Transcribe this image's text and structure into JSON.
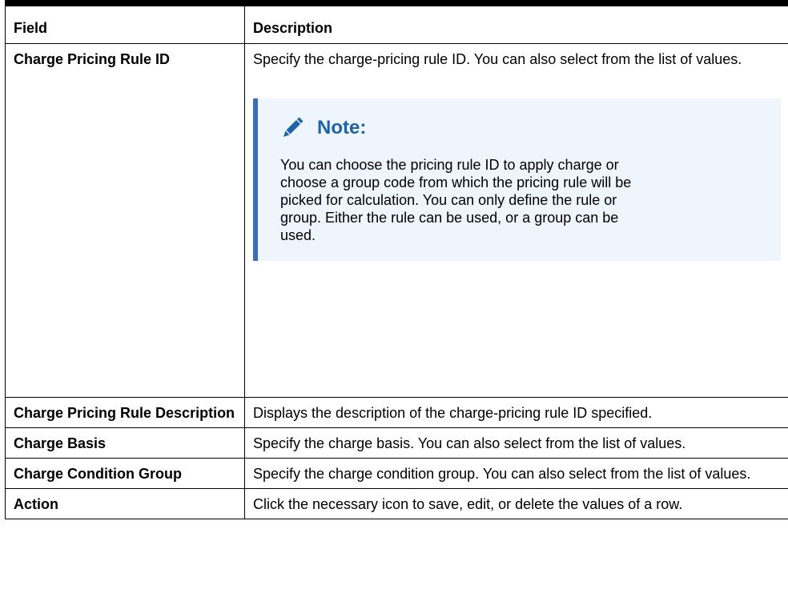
{
  "table": {
    "header": {
      "field": "Field",
      "description": "Description"
    },
    "rows": [
      {
        "field": "Charge Pricing Rule ID",
        "description": "Specify the charge-pricing rule ID. You can also select from the list of values.",
        "note": {
          "icon": "pencil-icon",
          "title": "Note:",
          "text": "You can choose the pricing rule ID to apply charge or choose a group code from which the pricing rule will be picked for calculation. You can only define the rule or group. Either the rule can be used, or a group can be used."
        }
      },
      {
        "field": "Charge Pricing Rule Description",
        "description": "Displays the description of the charge-pricing rule ID specified."
      },
      {
        "field": "Charge Basis",
        "description": "Specify the charge basis. You can also select from the list of values."
      },
      {
        "field": "Charge Condition Group",
        "description": "Specify the charge condition group. You can also select from the list of values."
      },
      {
        "field": "Action",
        "description": "Click the necessary icon to save, edit, or delete the values of a row."
      }
    ]
  },
  "colors": {
    "note_title": "#1c63ac",
    "note_background": "#eef5fc",
    "note_border": "#3d6fb6"
  }
}
